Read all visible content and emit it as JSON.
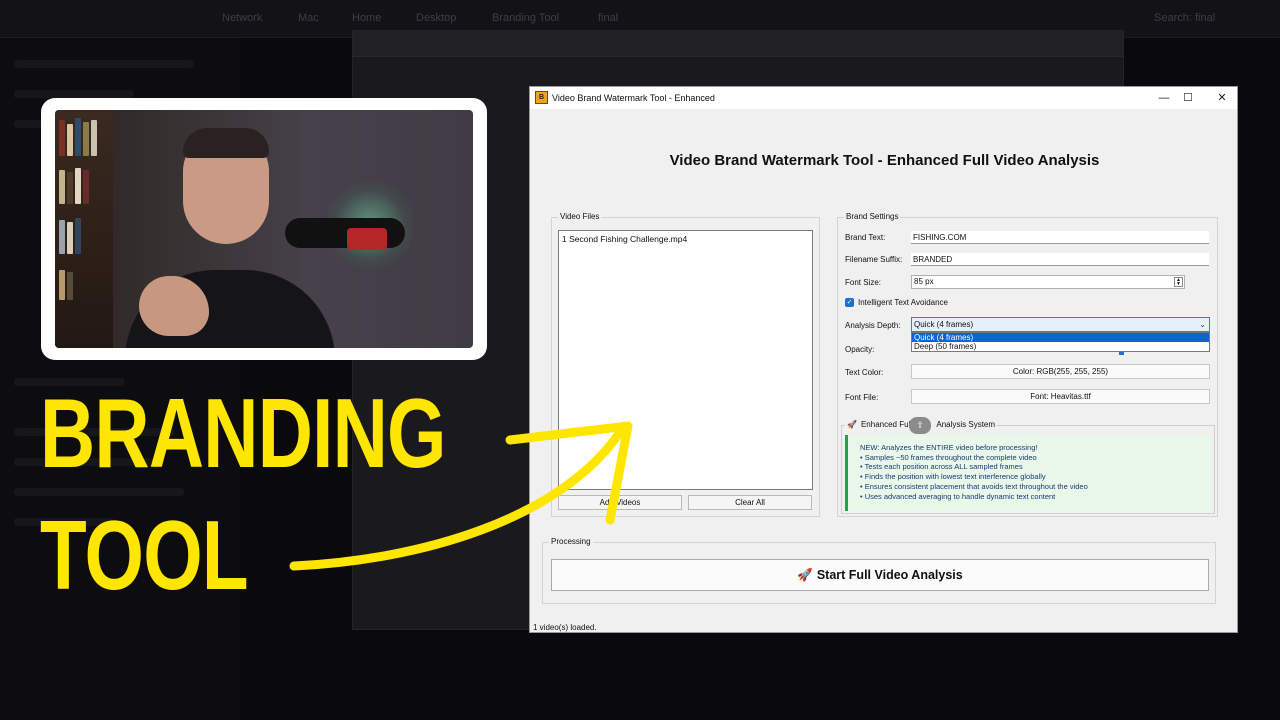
{
  "overlay": {
    "line1": "BRANDING",
    "line2": "TOOL",
    "accent_color": "#ffe600"
  },
  "app": {
    "window_title": "Video Brand Watermark Tool - Enhanced",
    "icon_label": "B",
    "heading": "Video Brand Watermark Tool - Enhanced Full Video Analysis",
    "window_controls": {
      "minimize": "—",
      "maximize": "☐",
      "close": "✕"
    },
    "video_files": {
      "label": "Video Files",
      "items": [
        "1 Second Fishing Challenge.mp4"
      ],
      "add_button": "Add Videos",
      "clear_button": "Clear All"
    },
    "brand_settings": {
      "label": "Brand Settings",
      "brand_text_label": "Brand Text:",
      "brand_text_value": "FISHING.COM",
      "suffix_label": "Filename Suffix:",
      "suffix_value": "BRANDED",
      "font_size_label": "Font Size:",
      "font_size_value": "85 px",
      "avoidance_label": "Intelligent Text Avoidance",
      "avoidance_checked": true,
      "depth_label": "Analysis Depth:",
      "depth_value": "Quick (4 frames)",
      "depth_options": [
        "Quick (4 frames)",
        "Deep (50 frames)"
      ],
      "opacity_label": "Opacity:",
      "text_color_label": "Text Color:",
      "text_color_button": "Color: RGB(255, 255, 255)",
      "font_file_label": "Font File:",
      "font_file_button": "Font: Heavitas.ttf"
    },
    "analysis_system": {
      "label": "Enhanced Full Video Analysis System",
      "label_prefix": "Enhanced Full",
      "label_suffix": "Analysis System",
      "lines": [
        "NEW: Analyzes the ENTIRE video before processing!",
        "• Samples ~50 frames throughout the complete video",
        "• Tests each position across ALL sampled frames",
        "• Finds the position with lowest text interference globally",
        "• Ensures consistent placement that avoids text throughout the video",
        "• Uses advanced averaging to handle dynamic text content"
      ]
    },
    "processing": {
      "label": "Processing",
      "start_button": "Start Full Video Analysis"
    },
    "status": "1 video(s) loaded."
  },
  "background": {
    "crumbs": [
      "Network",
      "Mac",
      "Home",
      "Desktop",
      "Branding Tool",
      "final"
    ],
    "search": "Search: final"
  }
}
